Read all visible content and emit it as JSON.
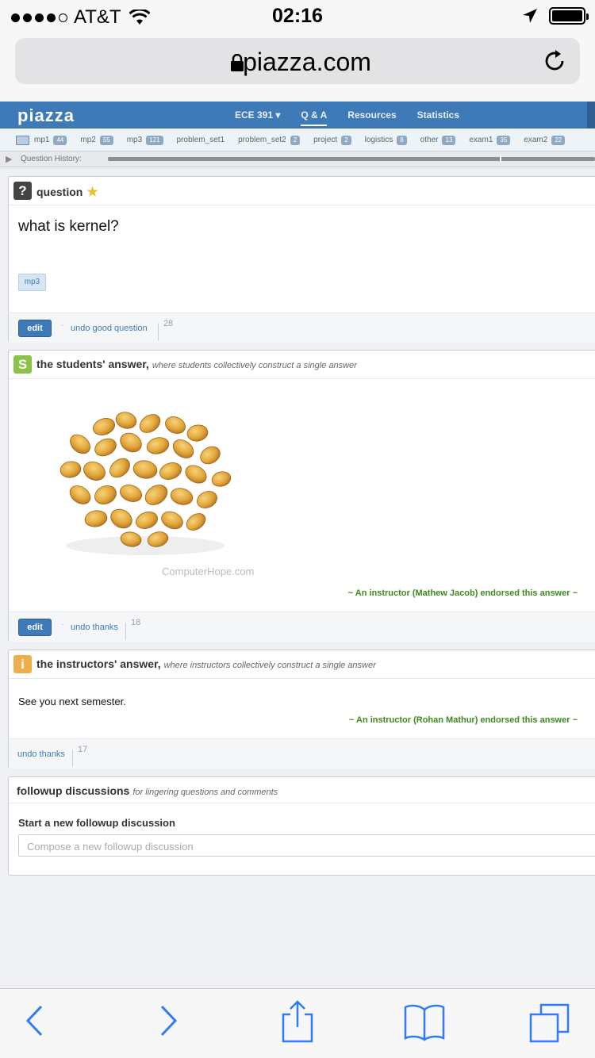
{
  "status": {
    "carrier": "AT&T",
    "time": "02:16",
    "battery_level": 1.0
  },
  "browser": {
    "url": "piazza.com"
  },
  "nav": {
    "logo": "piazza",
    "items": [
      {
        "label": "ECE 391 ▾",
        "active": false
      },
      {
        "label": "Q & A",
        "active": true
      },
      {
        "label": "Resources",
        "active": false
      },
      {
        "label": "Statistics",
        "active": false
      }
    ]
  },
  "folders": [
    {
      "label": "mp1",
      "count": "44"
    },
    {
      "label": "mp2",
      "count": "55"
    },
    {
      "label": "mp3",
      "count": "121"
    },
    {
      "label": "problem_set1",
      "count": ""
    },
    {
      "label": "problem_set2",
      "count": "2"
    },
    {
      "label": "project",
      "count": "2"
    },
    {
      "label": "logistics",
      "count": "8"
    },
    {
      "label": "other",
      "count": "13"
    },
    {
      "label": "exam1",
      "count": "35"
    },
    {
      "label": "exam2",
      "count": "22"
    }
  ],
  "history": {
    "label": "Question History:"
  },
  "question": {
    "header": "question",
    "body": "what is kernel?",
    "tag": "mp3",
    "edit_label": "edit",
    "good_label": "undo good question",
    "good_count": "28"
  },
  "students_answer": {
    "icon": "S",
    "title": "the students' answer,",
    "subtitle": "where students collectively construct a single answer",
    "image_credit": "ComputerHope.com",
    "endorsement": "~ An instructor (Mathew Jacob) endorsed this answer  ~",
    "edit_label": "edit",
    "thanks_label": "undo thanks",
    "thanks_count": "18"
  },
  "instructors_answer": {
    "icon": "i",
    "title": "the instructors' answer,",
    "subtitle": "where instructors collectively construct a single answer",
    "body": "See you next semester.",
    "endorsement": "~ An instructor (Rohan Mathur) endorsed this answer  ~",
    "thanks_label": "undo thanks",
    "thanks_count": "17"
  },
  "followup": {
    "title": "followup discussions",
    "subtitle": "for lingering questions and comments",
    "start_label": "Start a new followup discussion",
    "placeholder": "Compose a new followup discussion"
  },
  "colors": {
    "piazza_blue": "#3e7ab8",
    "students_green": "#8bc34a",
    "instructor_orange": "#f0ad4e",
    "endorse_green": "#3b8a1e",
    "ios_blue": "#2e7cf6"
  }
}
